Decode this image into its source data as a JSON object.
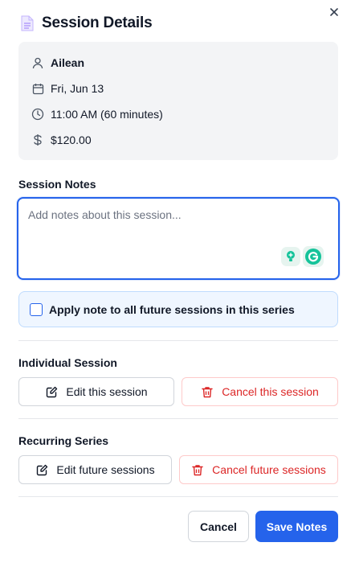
{
  "modal": {
    "title": "Session Details",
    "title_icon": "document-icon",
    "close_icon": "close-icon"
  },
  "session": {
    "client_name": "Ailean",
    "date": "Fri, Jun 13",
    "time": "11:00 AM (60 minutes)",
    "price": "$120.00",
    "icons": [
      "user-icon",
      "calendar-icon",
      "clock-icon",
      "dollar-icon"
    ]
  },
  "notes": {
    "label": "Session Notes",
    "placeholder": "Add notes about this session...",
    "value": ""
  },
  "apply_all": {
    "label": "Apply note to all future sessions in this series",
    "checked": false
  },
  "individual": {
    "heading": "Individual Session",
    "edit_label": "Edit this session",
    "cancel_label": "Cancel this session"
  },
  "recurring": {
    "heading": "Recurring Series",
    "edit_label": "Edit future sessions",
    "cancel_label": "Cancel future sessions"
  },
  "footer": {
    "cancel_label": "Cancel",
    "save_label": "Save Notes"
  },
  "colors": {
    "accent": "#2563eb",
    "danger": "#dc2626",
    "card_bg": "#f3f4f6",
    "info_bg": "#eff6ff"
  }
}
